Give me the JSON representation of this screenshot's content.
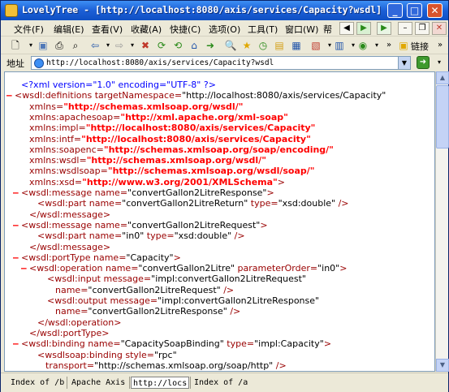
{
  "window": {
    "title": "LovelyTree - [http://localhost:8080/axis/services/Capacity?wsdl]"
  },
  "menu": [
    "文件(F)",
    "编辑(E)",
    "查看(V)",
    "收藏(A)",
    "快捷(C)",
    "选项(O)",
    "工具(T)",
    "窗口(W)",
    "帮"
  ],
  "toolbar": {
    "links_label": "链接"
  },
  "address": {
    "label": "地址",
    "value": "http://localhost:8080/axis/services/Capacity?wsdl"
  },
  "xml": {
    "pi": "<?xml version=\"1.0\" encoding=\"UTF-8\" ?>",
    "lines": [
      "<wsdl:definitions targetNamespace=\"http://localhost:8080/axis/services/Capacity\"",
      "xmlns=\"http://schemas.xmlsoap.org/wsdl/\"",
      "xmlns:apachesoap=\"http://xml.apache.org/xml-soap\"",
      "xmlns:impl=\"http://localhost:8080/axis/services/Capacity\"",
      "xmlns:intf=\"http://localhost:8080/axis/services/Capacity\"",
      "xmlns:soapenc=\"http://schemas.xmlsoap.org/soap/encoding/\"",
      "xmlns:wsdl=\"http://schemas.xmlsoap.org/wsdl/\"",
      "xmlns:wsdlsoap=\"http://schemas.xmlsoap.org/wsdl/soap/\"",
      "xmlns:xsd=\"http://www.w3.org/2001/XMLSchema\">",
      "<wsdl:message name=\"convertGallon2LitreResponse\">",
      "<wsdl:part name=\"convertGallon2LitreReturn\" type=\"xsd:double\" />",
      "</wsdl:message>",
      "<wsdl:message name=\"convertGallon2LitreRequest\">",
      "<wsdl:part name=\"in0\" type=\"xsd:double\" />",
      "</wsdl:message>",
      "<wsdl:portType name=\"Capacity\">",
      "<wsdl:operation name=\"convertGallon2Litre\" parameterOrder=\"in0\">",
      "<wsdl:input message=\"impl:convertGallon2LitreRequest\"",
      "name=\"convertGallon2LitreRequest\" />",
      "<wsdl:output message=\"impl:convertGallon2LitreResponse\"",
      "name=\"convertGallon2LitreResponse\" />",
      "</wsdl:operation>",
      "</wsdl:portType>",
      "<wsdl:binding name=\"CapacitySoapBinding\" type=\"impl:Capacity\">",
      "<wsdlsoap:binding style=\"rpc\"",
      "transport=\"http://schemas.xmlsoap.org/soap/http\" />"
    ],
    "toggle": "–"
  },
  "tabs": [
    "Index of /b",
    "Apache Axis",
    "http://locs",
    "Index of /a"
  ],
  "colors": {
    "title_bar": "#1C5FD6",
    "chrome": "#ECE9D8",
    "xml_markup": "#990000",
    "xml_ns": "#ff0000",
    "xml_pi": "#0000ff"
  }
}
